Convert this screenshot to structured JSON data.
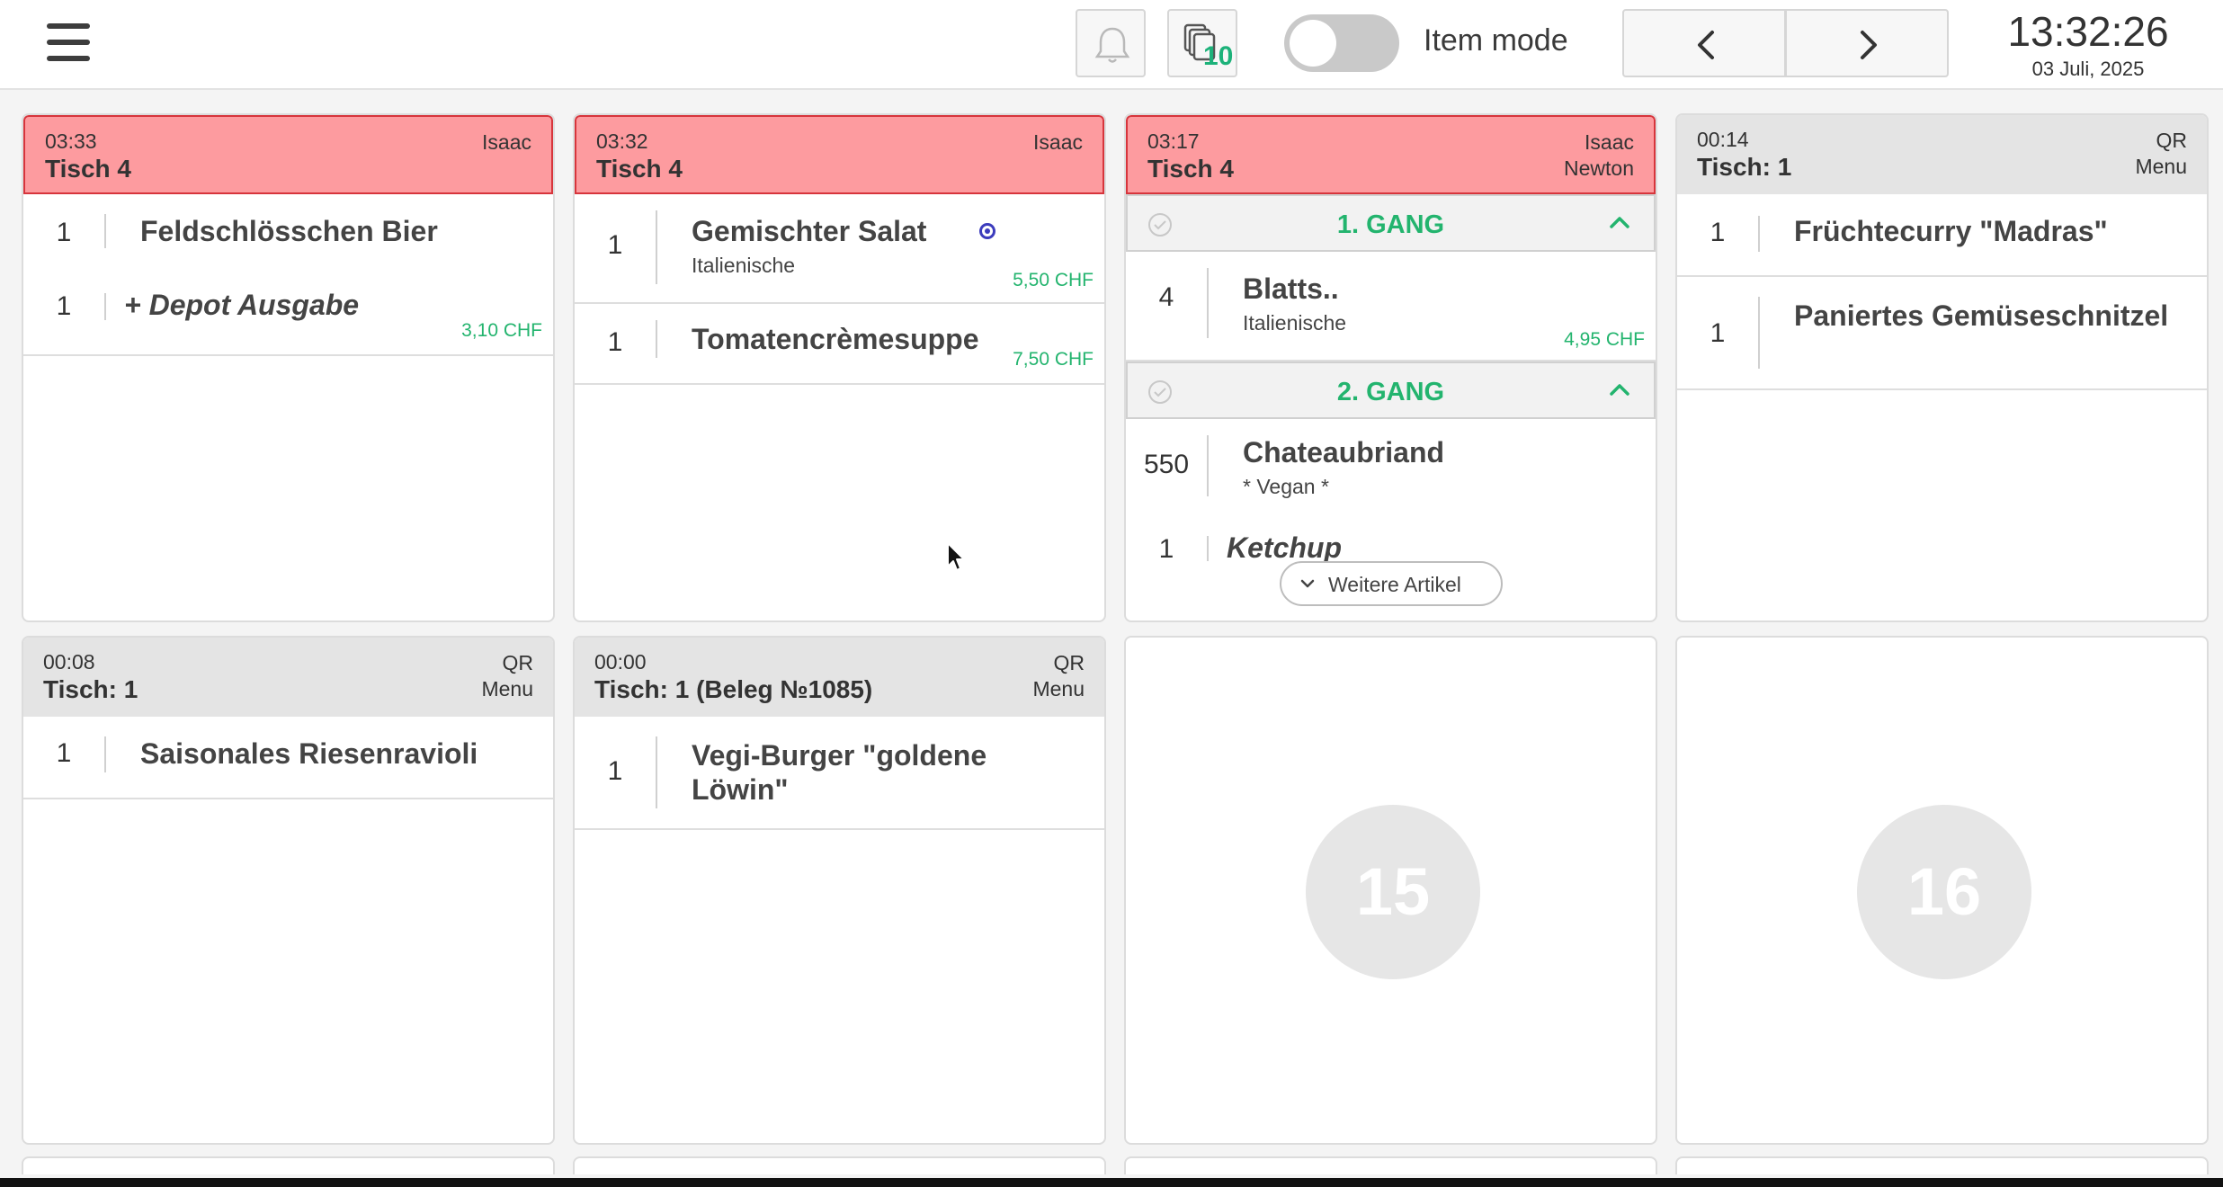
{
  "topbar": {
    "menu_icon": "hamburger-icon",
    "bell_icon": "bell-icon",
    "pages_icon": "stacked-pages-icon",
    "pages_count": "10",
    "item_mode_label": "Item mode",
    "item_mode_on": false,
    "prev_icon": "chevron-left-icon",
    "next_icon": "chevron-right-icon",
    "clock": "13:32:26",
    "date": "03 Juli, 2025"
  },
  "colors": {
    "accent_green": "#23b46e",
    "overdue_header": "#fd9b9f",
    "overdue_border": "#d7353c",
    "normal_header": "#e4e4e4",
    "modifier_dot": "#3c3cbd"
  },
  "orders": [
    {
      "time": "03:33",
      "table": "Tisch 4",
      "who": [
        "Isaac"
      ],
      "status": "overdue",
      "items": [
        {
          "qty": "1",
          "name": "Feldschlösschen Bier"
        },
        {
          "qty": "1",
          "name": "+ Depot Ausgabe",
          "price": "3,10 CHF"
        }
      ]
    },
    {
      "time": "03:32",
      "table": "Tisch 4",
      "who": [
        "Isaac"
      ],
      "status": "overdue",
      "items": [
        {
          "qty": "1",
          "name": "Gemischter Salat",
          "sub": "Italienische",
          "price": "5,50 CHF",
          "indicator": "modifier-dot"
        },
        {
          "qty": "1",
          "name": "Tomatencrèmesuppe",
          "price": "7,50 CHF"
        }
      ]
    },
    {
      "time": "03:17",
      "table": "Tisch 4",
      "who": [
        "Isaac",
        "Newton"
      ],
      "status": "overdue",
      "courses": [
        {
          "title": "1. GANG",
          "items": [
            {
              "qty": "4",
              "name": "Blatts..",
              "sub": "Italienische",
              "price": "4,95 CHF"
            }
          ]
        },
        {
          "title": "2. GANG",
          "items": [
            {
              "qty": "550",
              "name": "Chateaubriand",
              "sub": "* Vegan *"
            },
            {
              "qty": "1",
              "name": "Ketchup"
            }
          ]
        }
      ],
      "more_label": "Weitere Artikel"
    },
    {
      "time": "00:14",
      "table": "Tisch: 1",
      "who": [
        "QR",
        "Menu"
      ],
      "status": "normal",
      "items": [
        {
          "qty": "1",
          "name": "Früchtecurry \"Madras\""
        },
        {
          "qty": "1",
          "name": "Paniertes Gemüseschnitzel"
        }
      ]
    },
    {
      "time": "00:08",
      "table": "Tisch: 1",
      "who": [
        "QR",
        "Menu"
      ],
      "status": "normal",
      "items": [
        {
          "qty": "1",
          "name": "Saisonales Riesenravioli"
        }
      ]
    },
    {
      "time": "00:00",
      "table": "Tisch: 1 (Beleg №1085)",
      "who": [
        "QR",
        "Menu"
      ],
      "status": "normal",
      "items": [
        {
          "qty": "1",
          "name": "Vegi-Burger \"goldene Löwin\""
        }
      ]
    }
  ],
  "empty_slots": [
    "15",
    "16"
  ]
}
